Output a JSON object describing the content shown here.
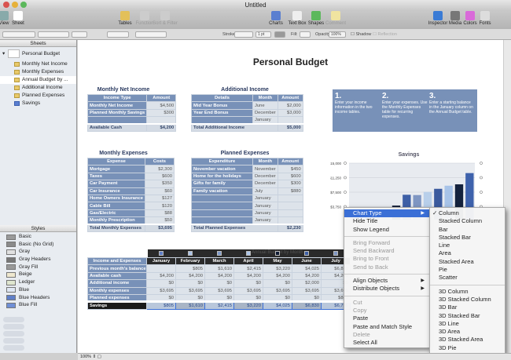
{
  "window": {
    "title": "Untitled"
  },
  "toolbar": {
    "left": [
      {
        "label": "View",
        "icon": "view-icon"
      },
      {
        "label": "Sheet",
        "icon": "sheet-icon"
      }
    ],
    "middle": [
      {
        "label": "Tables",
        "icon": "tables-icon",
        "enabled": true
      },
      {
        "label": "Function",
        "icon": "function-icon",
        "enabled": false
      },
      {
        "label": "Sort & Filter",
        "icon": "sort-filter-icon",
        "enabled": false
      }
    ],
    "insert": [
      {
        "label": "Charts",
        "icon": "charts-icon",
        "enabled": true
      },
      {
        "label": "Text Box",
        "icon": "text-box-icon",
        "enabled": true
      },
      {
        "label": "Shapes",
        "icon": "shapes-icon",
        "enabled": true
      },
      {
        "label": "Comment",
        "icon": "comment-icon",
        "enabled": false
      }
    ],
    "right": [
      {
        "label": "Inspector",
        "icon": "inspector-icon"
      },
      {
        "label": "Media",
        "icon": "media-icon"
      },
      {
        "label": "Colors",
        "icon": "colors-icon"
      },
      {
        "label": "Fonts",
        "icon": "fonts-icon"
      }
    ]
  },
  "format_bar": {
    "stroke_label": "Stroke:",
    "stroke_width": "1 pt",
    "fill_label": "Fill:",
    "opacity_label": "Opacity:",
    "opacity_value": "100%",
    "shadow_label": "Shadow",
    "reflection_label": "Reflection"
  },
  "sheets_panel": {
    "header": "Sheets",
    "sheet": "Personal Budget",
    "items": [
      "Monthly Net Income",
      "Monthly Expenses",
      "Annual Budget by ...",
      "Additional Income",
      "Planned Expenses",
      "Savings"
    ],
    "selected": "Annual Budget by ..."
  },
  "styles_panel": {
    "header": "Styles",
    "items": [
      {
        "label": "Basic",
        "swatch": "#9a9a9a"
      },
      {
        "label": "Basic (No Grid)",
        "swatch": "#8a8a8a"
      },
      {
        "label": "Gray",
        "swatch": "#e0e0e0"
      },
      {
        "label": "Gray Headers",
        "swatch": "#777777"
      },
      {
        "label": "Gray Fill",
        "swatch": "#999999"
      },
      {
        "label": "Beige",
        "swatch": "#efe8cf"
      },
      {
        "label": "Ledger",
        "swatch": "#dfe6cf"
      },
      {
        "label": "Blue",
        "swatch": "#dfe7f3"
      },
      {
        "label": "Blue Headers",
        "swatch": "#5f7fc8"
      },
      {
        "label": "Blue Fill",
        "swatch": "#6f8fd6"
      }
    ]
  },
  "document": {
    "title": "Personal Budget"
  },
  "monthly_net_income": {
    "title": "Monthly Net Income",
    "headers": [
      "Income Type",
      "Amount"
    ],
    "rows": [
      [
        "Monthly Net Income",
        "$4,500"
      ],
      [
        "Planned Monthly Savings",
        "$300"
      ],
      [
        "",
        ""
      ]
    ],
    "total": [
      "Available Cash",
      "$4,200"
    ]
  },
  "additional_income": {
    "title": "Additional Income",
    "headers": [
      "Details",
      "Month",
      "Amount"
    ],
    "rows": [
      [
        "Mid Year Bonus",
        "June",
        "$2,000"
      ],
      [
        "Year End Bonus",
        "December",
        "$3,000"
      ],
      [
        "",
        "January",
        ""
      ]
    ],
    "total": [
      "Total Additional Income",
      "$5,000"
    ]
  },
  "steps": [
    {
      "num": "1.",
      "text": "Enter your income information in the two income tables."
    },
    {
      "num": "2.",
      "text": "Enter your expenses. Use the Monthly Expenses table for recurring expenses."
    },
    {
      "num": "3.",
      "text": "Enter a starting balance in the January column on the Annual Budget table."
    }
  ],
  "monthly_expenses": {
    "title": "Monthly Expenses",
    "headers": [
      "Expense",
      "Costs"
    ],
    "rows": [
      [
        "Mortgage",
        "$2,300"
      ],
      [
        "Taxes",
        "$600"
      ],
      [
        "Car Payment",
        "$350"
      ],
      [
        "Car Insurance",
        "$60"
      ],
      [
        "Home Owners Insurance",
        "$127"
      ],
      [
        "Cable Bill",
        "$120"
      ],
      [
        "Gas/Electric",
        "$88"
      ],
      [
        "Monthly Prescription",
        "$50"
      ]
    ],
    "total": [
      "Total Monthly Expenses",
      "$3,695"
    ]
  },
  "planned_expenses": {
    "title": "Planned Expenses",
    "headers": [
      "Expenditure",
      "Month",
      "Amount"
    ],
    "rows": [
      [
        "November vacation",
        "November",
        "$450"
      ],
      [
        "Home for the holidays",
        "December",
        "$600"
      ],
      [
        "Gifts for family",
        "December",
        "$300"
      ],
      [
        "Family vacation",
        "July",
        "$880"
      ],
      [
        "",
        "January",
        ""
      ],
      [
        "",
        "January",
        ""
      ],
      [
        "",
        "January",
        ""
      ],
      [
        "",
        "January",
        ""
      ]
    ],
    "total": [
      "Total Planned Expenses",
      "$2,230"
    ]
  },
  "annual_budget": {
    "overlay_title": "Annual Budget by Month",
    "headers": [
      "Income and Expenses",
      "January",
      "February",
      "March",
      "April",
      "May",
      "June",
      "July"
    ],
    "rows": [
      [
        "Previous month's balance",
        "",
        "$805",
        "$1,610",
        "$2,415",
        "$3,220",
        "$4,025",
        "$6,830"
      ],
      [
        "Available cash",
        "$4,200",
        "$4,200",
        "$4,200",
        "$4,200",
        "$4,200",
        "$4,200",
        "$4,200"
      ],
      [
        "Additional income",
        "$0",
        "$0",
        "$0",
        "$0",
        "$0",
        "$2,000",
        "$0"
      ],
      [
        "Monthly expenses",
        "$3,695",
        "$3,695",
        "$3,695",
        "$3,695",
        "$3,695",
        "$3,695",
        "$3,695"
      ],
      [
        "Planned expenses",
        "$0",
        "$0",
        "$0",
        "$0",
        "$0",
        "$0",
        "$880"
      ]
    ],
    "savings": [
      "Savings",
      "$805",
      "$1,610",
      "$2,415",
      "$3,220",
      "$4,025",
      "$6,830",
      "$6,755"
    ]
  },
  "chart_data": {
    "type": "bar",
    "title": "Savings",
    "categories": [
      "January",
      "February",
      "March",
      "April",
      "May",
      "June",
      "July",
      "August",
      "September",
      "October",
      "November",
      "December"
    ],
    "values": [
      805,
      1610,
      2415,
      3220,
      4025,
      6830,
      6755,
      7560,
      8365,
      9170,
      9525,
      12430
    ],
    "ylim": [
      0,
      15000
    ],
    "yticks": [
      "$3,750",
      "$7,500",
      "$11,250",
      "$15,000"
    ],
    "grid": true,
    "legend": "none",
    "colors": [
      "#5f7fc8",
      "#a9c2e6",
      "#7e9acb",
      "#aac4e8",
      "#0e1a33",
      "#3d5fa6",
      "#7f96c2",
      "#b8cfea",
      "#3a5a9e",
      "#a7c3e8",
      "#14223d",
      "#3e62ac"
    ]
  },
  "context_menu": {
    "groups": [
      [
        {
          "label": "Chart Type",
          "submenu": true,
          "highlighted": true
        },
        {
          "label": "Hide Title"
        },
        {
          "label": "Show Legend"
        }
      ],
      [
        {
          "label": "Bring Forward",
          "disabled": true
        },
        {
          "label": "Send Backward",
          "disabled": true
        },
        {
          "label": "Bring to Front",
          "disabled": true
        },
        {
          "label": "Send to Back",
          "disabled": true
        }
      ],
      [
        {
          "label": "Align Objects",
          "submenu": true
        },
        {
          "label": "Distribute Objects",
          "submenu": true
        }
      ],
      [
        {
          "label": "Cut",
          "disabled": true
        },
        {
          "label": "Copy",
          "disabled": true
        },
        {
          "label": "Paste"
        },
        {
          "label": "Paste and Match Style"
        },
        {
          "label": "Delete",
          "disabled": true
        },
        {
          "label": "Select All"
        }
      ]
    ]
  },
  "chart_type_submenu": {
    "checked": "Column",
    "groups": [
      [
        "Column",
        "Stacked Column",
        "Bar",
        "Stacked Bar",
        "Line",
        "Area",
        "Stacked Area",
        "Pie",
        "Scatter"
      ],
      [
        "3D Column",
        "3D Stacked Column",
        "3D Bar",
        "3D Stacked Bar",
        "3D Line",
        "3D Area",
        "3D Stacked Area",
        "3D Pie"
      ]
    ]
  },
  "status_bar": {
    "zoom": "100%"
  }
}
